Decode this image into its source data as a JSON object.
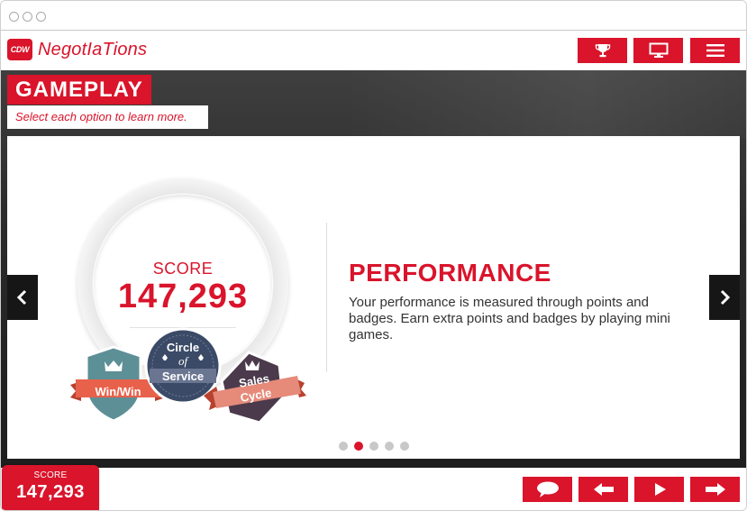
{
  "app": {
    "logo_text": "CDW",
    "title": "NegotIaTions"
  },
  "header_buttons": [
    {
      "icon": "trophy-icon"
    },
    {
      "icon": "monitor-icon"
    },
    {
      "icon": "menu-icon"
    }
  ],
  "section": {
    "title": "GAMEPLAY",
    "subtitle": "Select each option to learn more."
  },
  "slide": {
    "score_label": "SCORE",
    "score_value": "147,293",
    "badges": {
      "win_win": "Win/Win",
      "circle_line1": "Circle",
      "circle_line2": "of",
      "circle_line3": "Service",
      "sales_line1": "Sales",
      "sales_line2": "Cycle"
    },
    "heading": "PERFORMANCE",
    "body": "Your performance is measured through points and badges. Earn extra points and badges by playing mini games.",
    "pagination": {
      "total": 5,
      "active_index": 1
    }
  },
  "footer": {
    "score_label": "SCORE",
    "score_value": "147,293",
    "buttons": [
      {
        "icon": "speech-bubble-icon"
      },
      {
        "icon": "back-arrow-icon"
      },
      {
        "icon": "play-icon"
      },
      {
        "icon": "forward-arrow-icon"
      }
    ]
  },
  "colors": {
    "brand_red": "#d9142b",
    "dark": "#161616",
    "teal_badge": "#5d8f96",
    "navy_badge": "#3b4a67",
    "plum_badge": "#4b3a4c",
    "coral_ribbon": "#e8614b"
  }
}
